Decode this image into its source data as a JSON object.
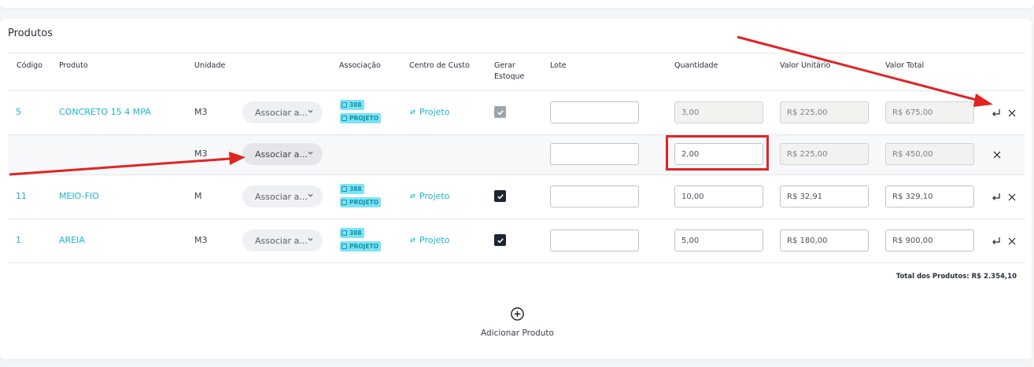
{
  "section_title": "Produtos",
  "columns": {
    "codigo": "Código",
    "produto": "Produto",
    "unidade": "Unidade",
    "associacao": "Associação",
    "centro_custo": "Centro de Custo",
    "gerar_estoque_1": "Gerar",
    "gerar_estoque_2": "Estoque",
    "lote": "Lote",
    "quantidade": "Quantidade",
    "valor_unitario": "Valor Unitário",
    "valor_total": "Valor Total"
  },
  "rows": [
    {
      "codigo": "5",
      "produto": "CONCRETO 15 4 MPA",
      "unidade": "M3",
      "select_label": "Associar a...",
      "badge_number": "388",
      "badge_tag": "PROJETO",
      "centro_custo": "Projeto",
      "gerar_estoque": "checked-disabled",
      "lote": "",
      "quantidade": "3,00",
      "valor_unitario": "R$ 225,00",
      "valor_total": "R$ 675,00"
    },
    {
      "unidade": "M3",
      "select_label": "Associar a...",
      "lote": "",
      "quantidade": "2,00",
      "valor_unitario": "R$ 225,00",
      "valor_total": "R$ 450,00"
    },
    {
      "codigo": "11",
      "produto": "MEIO-FIO",
      "unidade": "M",
      "select_label": "Associar a...",
      "badge_number": "388",
      "badge_tag": "PROJETO",
      "centro_custo": "Projeto",
      "gerar_estoque": "checked",
      "lote": "",
      "quantidade": "10,00",
      "valor_unitario": "R$ 32,91",
      "valor_total": "R$ 329,10"
    },
    {
      "codigo": "1",
      "produto": "AREIA",
      "unidade": "M3",
      "select_label": "Associar a...",
      "badge_number": "388",
      "badge_tag": "PROJETO",
      "centro_custo": "Projeto",
      "gerar_estoque": "checked",
      "lote": "",
      "quantidade": "5,00",
      "valor_unitario": "R$ 180,00",
      "valor_total": "R$ 900,00"
    }
  ],
  "total_label": "Total dos Produtos: R$ 2.354,10",
  "add_product_label": "Adicionar Produto",
  "colors": {
    "accent": "#1ab4cf",
    "badge_bg": "#7ee3f2",
    "annotation_red": "#e02424",
    "checkbox_on": "#1f2633"
  },
  "icons": [
    "chevron-down-icon",
    "calendar-icon",
    "project-icon",
    "swap-icon",
    "check-icon",
    "split-return-icon",
    "close-icon",
    "plus-circle-icon"
  ]
}
